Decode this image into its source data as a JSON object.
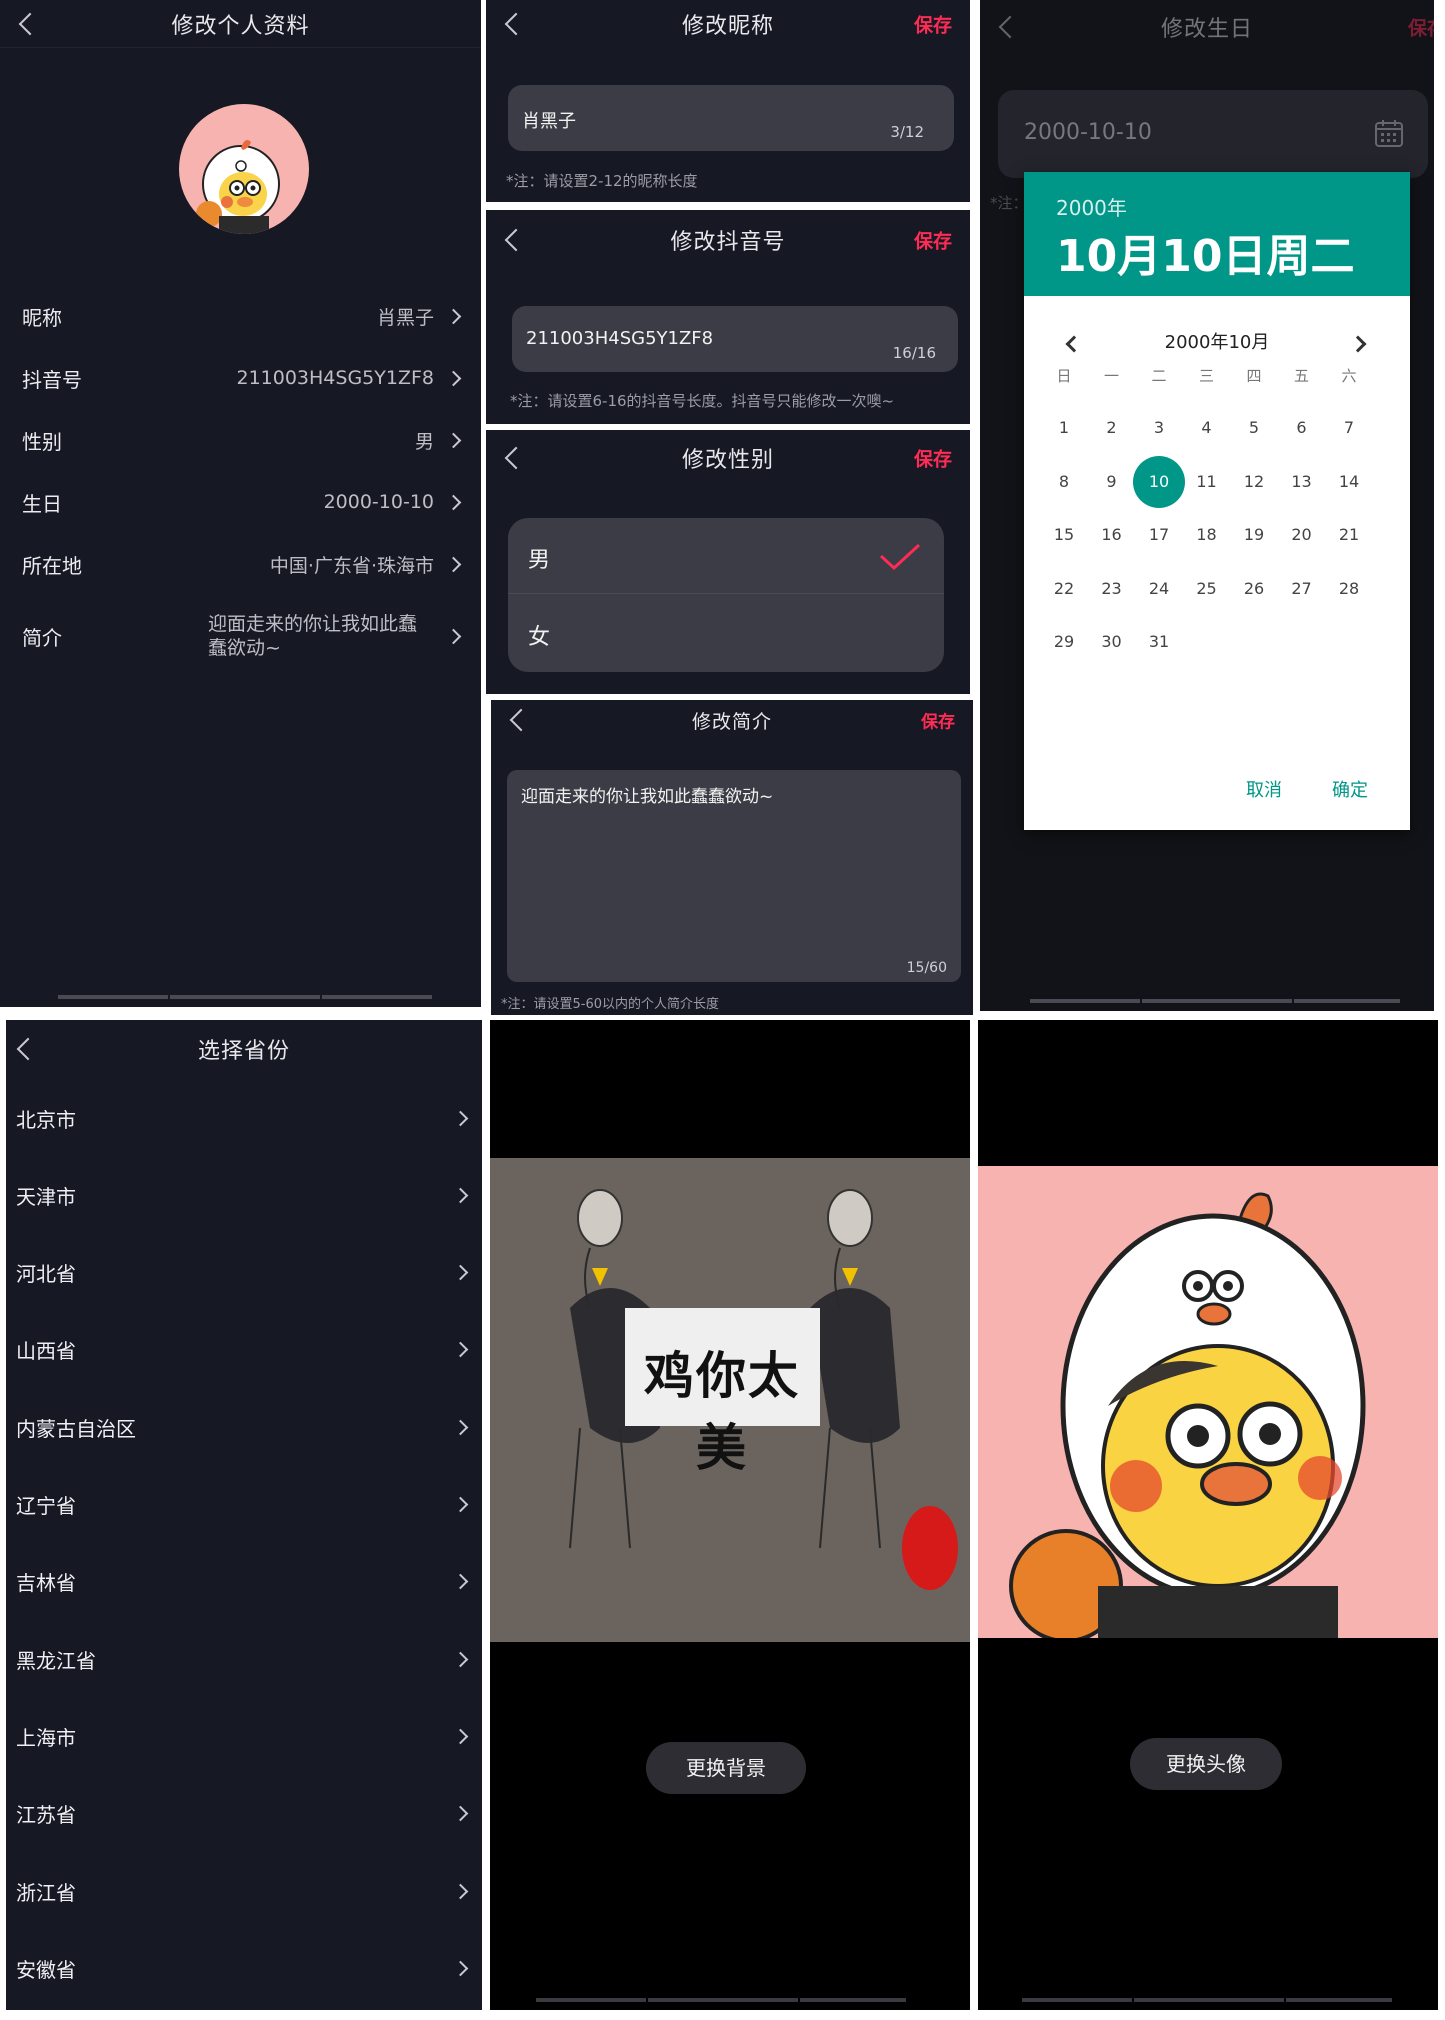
{
  "profile": {
    "title": "修改个人资料",
    "rows": [
      {
        "label": "昵称",
        "value": "肖黑子"
      },
      {
        "label": "抖音号",
        "value": "211003H4SG5Y1ZF8"
      },
      {
        "label": "性别",
        "value": "男"
      },
      {
        "label": "生日",
        "value": "2000-10-10"
      },
      {
        "label": "所在地",
        "value": "中国·广东省·珠海市"
      },
      {
        "label": "简介",
        "value": "迎面走来的你让我如此蠢",
        "value2": "蠢欲动~"
      }
    ]
  },
  "nickname": {
    "title": "修改昵称",
    "save": "保存",
    "value": "肖黑子",
    "counter": "3/12",
    "note": "*注：请设置2-12的昵称长度"
  },
  "douyin_id": {
    "title": "修改抖音号",
    "save": "保存",
    "value": "211003H4SG5Y1ZF8",
    "counter": "16/16",
    "note": "*注：请设置6-16的抖音号长度。抖音号只能修改一次噢~"
  },
  "gender": {
    "title": "修改性别",
    "save": "保存",
    "options": [
      "男",
      "女"
    ],
    "selected": "男"
  },
  "bio": {
    "title": "修改简介",
    "save": "保存",
    "value": "迎面走来的你让我如此蠢蠢欲动~",
    "counter": "15/60",
    "note": "*注：请设置5-60以内的个人简介长度"
  },
  "birthday": {
    "title": "修改生日",
    "save": "保存",
    "value": "2000-10-10",
    "note_stub": "*注：",
    "picker": {
      "year": "2000年",
      "date": "10月10日周二",
      "month_label": "2000年10月",
      "weekdays": [
        "日",
        "一",
        "二",
        "三",
        "四",
        "五",
        "六"
      ],
      "days": [
        "1",
        "2",
        "3",
        "4",
        "5",
        "6",
        "7",
        "8",
        "9",
        "10",
        "11",
        "12",
        "13",
        "14",
        "15",
        "16",
        "17",
        "18",
        "19",
        "20",
        "21",
        "22",
        "23",
        "24",
        "25",
        "26",
        "27",
        "28",
        "29",
        "30",
        "31"
      ],
      "selected": "10",
      "cancel": "取消",
      "ok": "确定"
    }
  },
  "province": {
    "title": "选择省份",
    "items": [
      "北京市",
      "天津市",
      "河北省",
      "山西省",
      "内蒙古自治区",
      "辽宁省",
      "吉林省",
      "黑龙江省",
      "上海市",
      "江苏省",
      "浙江省",
      "安徽省"
    ]
  },
  "background": {
    "sign_text": "鸡你太美",
    "button": "更换背景"
  },
  "avatar": {
    "button": "更换头像"
  },
  "colors": {
    "accent": "#fe2c55",
    "teal": "#009688",
    "panel": "#161823",
    "avatar_bg": "#f7b3b0"
  }
}
